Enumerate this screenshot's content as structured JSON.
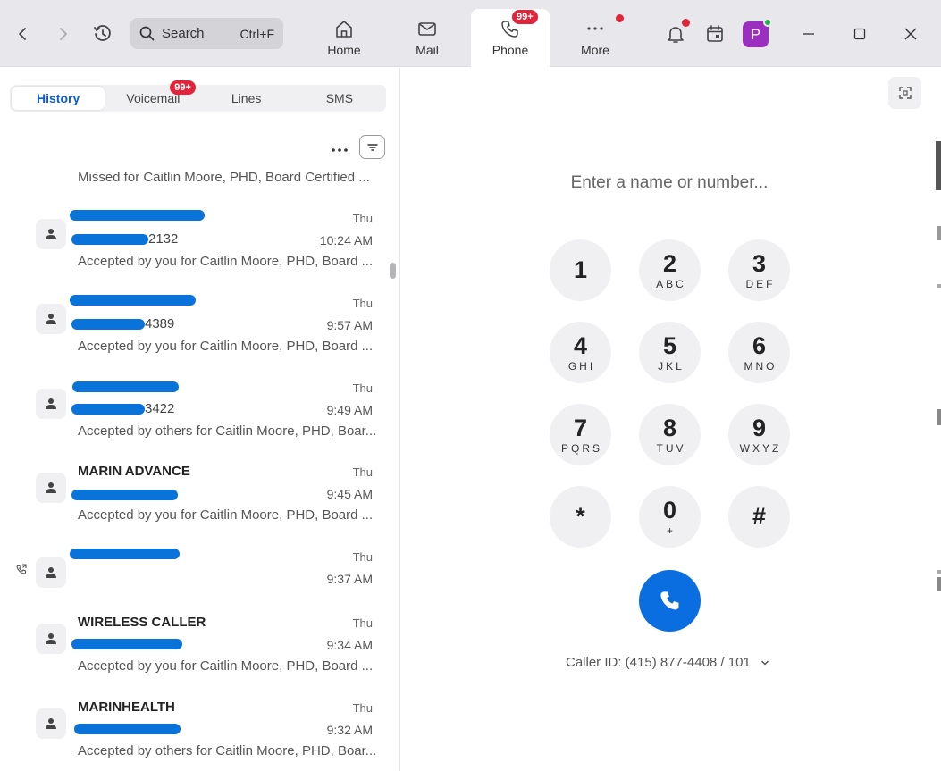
{
  "titlebar": {
    "search_label": "Search",
    "search_shortcut": "Ctrl+F",
    "tabs": [
      {
        "label": "Home",
        "icon": "home-icon"
      },
      {
        "label": "Mail",
        "icon": "mail-icon"
      },
      {
        "label": "Phone",
        "icon": "phone-icon",
        "badge": "99+"
      },
      {
        "label": "More",
        "icon": "more-icon"
      }
    ],
    "avatar_letter": "P"
  },
  "history": {
    "tabs": [
      {
        "label": "History"
      },
      {
        "label": "Voicemail",
        "badge": "99+"
      },
      {
        "label": "Lines"
      },
      {
        "label": "SMS"
      }
    ],
    "missed_text": "Missed for Caitlin Moore, PHD, Board Certified ...",
    "rows": [
      {
        "name": "",
        "number": "2132",
        "day": "Thu",
        "time": "10:24 AM",
        "desc": "Accepted by you for Caitlin Moore, PHD, Board ..."
      },
      {
        "name": "",
        "number": "4389",
        "day": "Thu",
        "time": "9:57 AM",
        "desc": "Accepted by you for Caitlin Moore, PHD, Board ..."
      },
      {
        "name": "",
        "number": "3422",
        "day": "Thu",
        "time": "9:49 AM",
        "desc": "Accepted by others for Caitlin Moore, PHD, Boar..."
      },
      {
        "name": "MARIN ADVANCE",
        "number": "",
        "day": "Thu",
        "time": "9:45 AM",
        "desc": "Accepted by you for Caitlin Moore, PHD, Board ..."
      },
      {
        "name": "",
        "number": "",
        "day": "Thu",
        "time": "9:37 AM",
        "desc": ""
      },
      {
        "name": "WIRELESS CALLER",
        "number": "",
        "day": "Thu",
        "time": "9:34 AM",
        "desc": "Accepted by you for Caitlin Moore, PHD, Board ..."
      },
      {
        "name": "MARINHEALTH",
        "number": "",
        "day": "Thu",
        "time": "9:32 AM",
        "desc": "Accepted by others for Caitlin Moore, PHD, Boar..."
      }
    ]
  },
  "dialer": {
    "placeholder": "Enter a name or number...",
    "keys": [
      {
        "digit": "1",
        "letters": ""
      },
      {
        "digit": "2",
        "letters": "ABC"
      },
      {
        "digit": "3",
        "letters": "DEF"
      },
      {
        "digit": "4",
        "letters": "GHI"
      },
      {
        "digit": "5",
        "letters": "JKL"
      },
      {
        "digit": "6",
        "letters": "MNO"
      },
      {
        "digit": "7",
        "letters": "PQRS"
      },
      {
        "digit": "8",
        "letters": "TUV"
      },
      {
        "digit": "9",
        "letters": "WXYZ"
      },
      {
        "digit": "*",
        "letters": ""
      },
      {
        "digit": "0",
        "letters": "+"
      },
      {
        "digit": "#",
        "letters": ""
      }
    ],
    "caller_id": "Caller ID: (415) 877-4408 / 101"
  },
  "colors": {
    "accent": "#0b6ee0",
    "badge": "#e0243a",
    "redaction": "#0a73d9",
    "avatar": "#9b2fc0"
  }
}
